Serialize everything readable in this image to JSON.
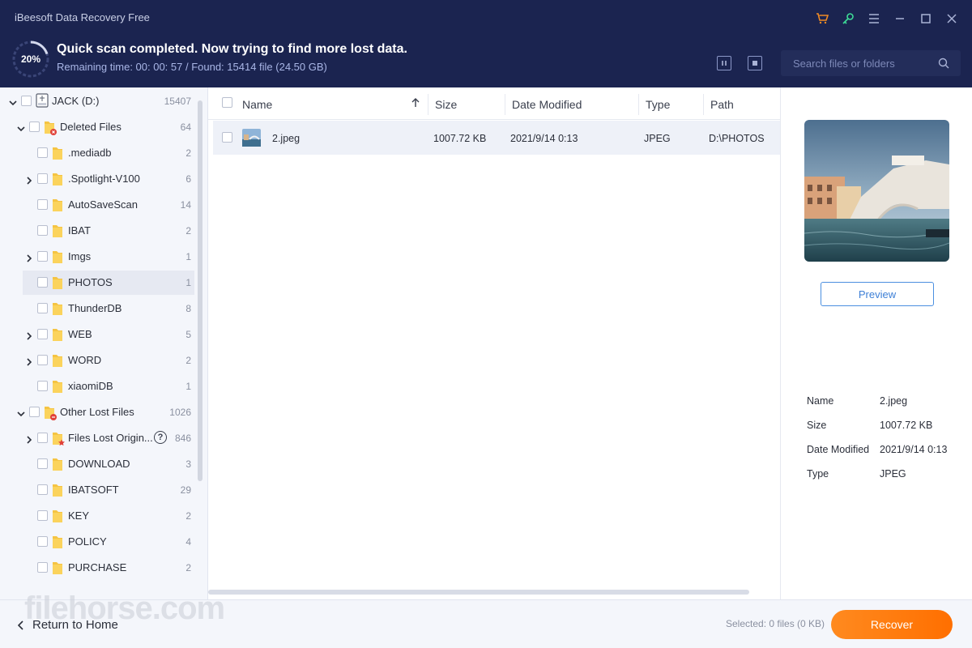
{
  "app": {
    "title": "iBeesoft Data Recovery Free"
  },
  "window_controls": [
    {
      "name": "cart-icon"
    },
    {
      "name": "key-icon"
    },
    {
      "name": "menu-icon"
    },
    {
      "name": "minimize-icon"
    },
    {
      "name": "maximize-icon"
    },
    {
      "name": "close-icon"
    }
  ],
  "scan": {
    "progress_label": "20%",
    "progress": 0.2,
    "status": "Quick scan completed. Now trying to find more lost data.",
    "details": "Remaining time: 00: 00: 57 / Found: 15414 file (24.50 GB)"
  },
  "search": {
    "placeholder": "Search files or folders"
  },
  "tree": {
    "drive": {
      "label": "JACK (D:)",
      "count": "15407"
    },
    "deleted": {
      "label": "Deleted Files",
      "count": "64",
      "items": [
        {
          "label": ".mediadb",
          "count": "2",
          "expandable": false
        },
        {
          "label": ".Spotlight-V100",
          "count": "6",
          "expandable": true
        },
        {
          "label": "AutoSaveScan",
          "count": "14",
          "expandable": false
        },
        {
          "label": "IBAT",
          "count": "2",
          "expandable": false
        },
        {
          "label": "Imgs",
          "count": "1",
          "expandable": true
        },
        {
          "label": "PHOTOS",
          "count": "1",
          "expandable": false,
          "selected": true
        },
        {
          "label": "ThunderDB",
          "count": "8",
          "expandable": false
        },
        {
          "label": "WEB",
          "count": "5",
          "expandable": true
        },
        {
          "label": "WORD",
          "count": "2",
          "expandable": true
        },
        {
          "label": "xiaomiDB",
          "count": "1",
          "expandable": false
        }
      ]
    },
    "other": {
      "label": "Other Lost Files",
      "count": "1026",
      "items": [
        {
          "label": "Files Lost Origin...",
          "count": "846",
          "expandable": true,
          "help": "?"
        },
        {
          "label": "DOWNLOAD",
          "count": "3",
          "expandable": false
        },
        {
          "label": "IBATSOFT",
          "count": "29",
          "expandable": false
        },
        {
          "label": "KEY",
          "count": "2",
          "expandable": false
        },
        {
          "label": "POLICY",
          "count": "4",
          "expandable": false
        },
        {
          "label": "PURCHASE",
          "count": "2",
          "expandable": false
        }
      ]
    }
  },
  "columns": {
    "name": "Name",
    "size": "Size",
    "date": "Date Modified",
    "type": "Type",
    "path": "Path"
  },
  "files": [
    {
      "name": "2.jpeg",
      "size": "1007.72 KB",
      "date": "2021/9/14 0:13",
      "type": "JPEG",
      "path": "D:\\PHOTOS"
    }
  ],
  "preview": {
    "button": "Preview",
    "info": [
      {
        "label": "Name",
        "value": "2.jpeg"
      },
      {
        "label": "Size",
        "value": "1007.72 KB"
      },
      {
        "label": "Date Modified",
        "value": "2021/9/14 0:13"
      },
      {
        "label": "Type",
        "value": "JPEG"
      }
    ]
  },
  "footer": {
    "back": "Return to Home",
    "selected": "Selected: 0 files (0 KB)",
    "recover": "Recover",
    "watermark": "filehorse.com"
  },
  "colors": {
    "header_bg": "#1b2450",
    "accent_orange": "#ff7a10",
    "accent_blue": "#3d7fd6",
    "key_green": "#3ddc97",
    "cart_orange": "#f08a24"
  }
}
